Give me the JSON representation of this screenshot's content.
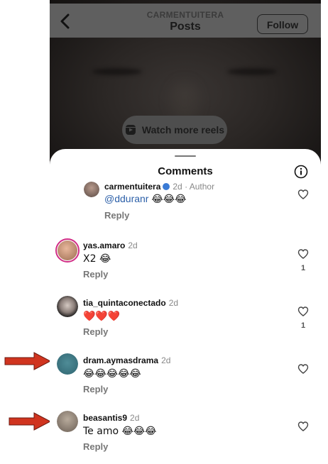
{
  "header": {
    "username": "CARMENTUITERA",
    "title": "Posts",
    "follow_label": "Follow"
  },
  "reels_button": {
    "label": "Watch more reels"
  },
  "comments_sheet": {
    "title": "Comments",
    "comments": [
      {
        "username": "carmentuitera",
        "verified": true,
        "time": "2d",
        "author_tag": "Author",
        "mention": "@dduranr",
        "text": "😂😂😂",
        "reply_label": "Reply",
        "likes": ""
      },
      {
        "username": "yas.amaro",
        "time": "2d",
        "text": "X2 😂",
        "reply_label": "Reply",
        "likes": "1"
      },
      {
        "username": "tia_quintaconectado",
        "time": "2d",
        "text": "❤️❤️❤️",
        "reply_label": "Reply",
        "likes": "1"
      },
      {
        "username": "dram.aymasdrama",
        "time": "2d",
        "text": "😂😂😂😂😂",
        "reply_label": "Reply",
        "likes": ""
      },
      {
        "username": "beasantis9",
        "time": "2d",
        "text": "Te amo 😂😂😂",
        "reply_label": "Reply",
        "likes": ""
      }
    ]
  },
  "colors": {
    "arrow": "#d0341f",
    "mention": "#2b5fa8",
    "avatar_ring": "#d12d86"
  },
  "icons": [
    "back-chevron",
    "reels",
    "info",
    "heart",
    "annotation-arrow"
  ]
}
